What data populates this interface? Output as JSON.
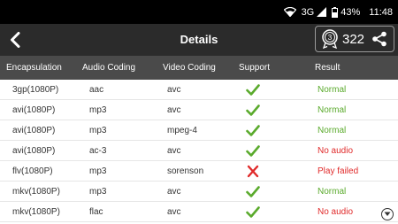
{
  "status_bar": {
    "network": "3G",
    "battery": "43%",
    "time": "11:48"
  },
  "app_bar": {
    "title": "Details",
    "score": "322"
  },
  "columns": [
    "Encapsulation",
    "Audio Coding",
    "Video Coding",
    "Support",
    "Result"
  ],
  "rows": [
    {
      "enc": "3gp(1080P)",
      "audio": "aac",
      "video": "avc",
      "support": "check",
      "result": "Normal",
      "status": "normal"
    },
    {
      "enc": "avi(1080P)",
      "audio": "mp3",
      "video": "avc",
      "support": "check",
      "result": "Normal",
      "status": "normal"
    },
    {
      "enc": "avi(1080P)",
      "audio": "mp3",
      "video": "mpeg-4",
      "support": "check",
      "result": "Normal",
      "status": "normal"
    },
    {
      "enc": "avi(1080P)",
      "audio": "ac-3",
      "video": "avc",
      "support": "check",
      "result": "No audio",
      "status": "bad"
    },
    {
      "enc": "flv(1080P)",
      "audio": "mp3",
      "video": "sorenson",
      "support": "cross",
      "result": "Play failed",
      "status": "bad"
    },
    {
      "enc": "mkv(1080P)",
      "audio": "mp3",
      "video": "avc",
      "support": "check",
      "result": "Normal",
      "status": "normal"
    },
    {
      "enc": "mkv(1080P)",
      "audio": "flac",
      "video": "avc",
      "support": "check",
      "result": "No audio",
      "status": "bad"
    }
  ],
  "colors": {
    "normal": "#5aaa2c",
    "bad": "#e02a2a",
    "header": "#4a4a4a",
    "app_bar": "#2b2b2b"
  },
  "icons": {
    "back": "chevron-left-icon",
    "medal": "medal-icon",
    "share": "share-icon",
    "support_ok": "check-icon",
    "support_fail": "cross-icon",
    "scroll": "chevron-down-circle-icon"
  }
}
